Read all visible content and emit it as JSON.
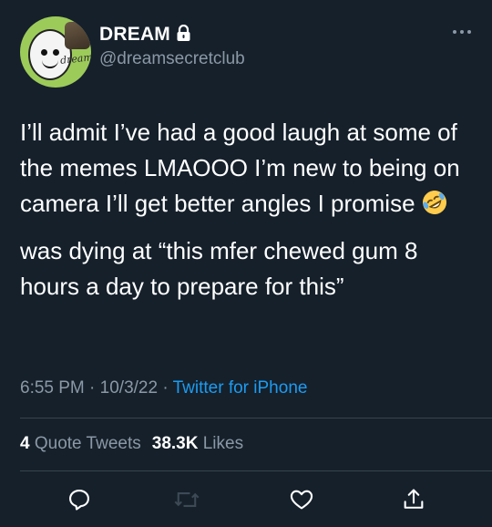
{
  "account": {
    "display_name": "DREAM",
    "handle": "@dreamsecretclub",
    "avatar_text": "dream"
  },
  "tweet": {
    "paragraph_1": "I’ll admit I’ve had a good laugh at some of the memes LMAOOO I’m new to being on camera I’ll get better angles I promise",
    "emoji": "rolling-on-the-floor-laughing",
    "paragraph_2": "was dying at “this mfer chewed gum 8 hours a day to prepare for this”"
  },
  "meta": {
    "time": "6:55 PM",
    "date": "10/3/22",
    "separator": " · ",
    "source": "Twitter for iPhone"
  },
  "stats": {
    "quote_count": "4",
    "quote_label": "Quote Tweets",
    "like_count": "38.3K",
    "like_label": "Likes"
  },
  "icons": {
    "lock": "lock-icon",
    "more": "more-icon",
    "reply": "reply-icon",
    "retweet": "retweet-icon",
    "like": "like-icon",
    "share": "share-icon"
  },
  "colors": {
    "background": "#15202b",
    "text": "#ffffff",
    "secondary": "#8b98a5",
    "accent": "#1d9bf0",
    "divider": "#38444d",
    "retweet_disabled": "#3d4a56"
  }
}
